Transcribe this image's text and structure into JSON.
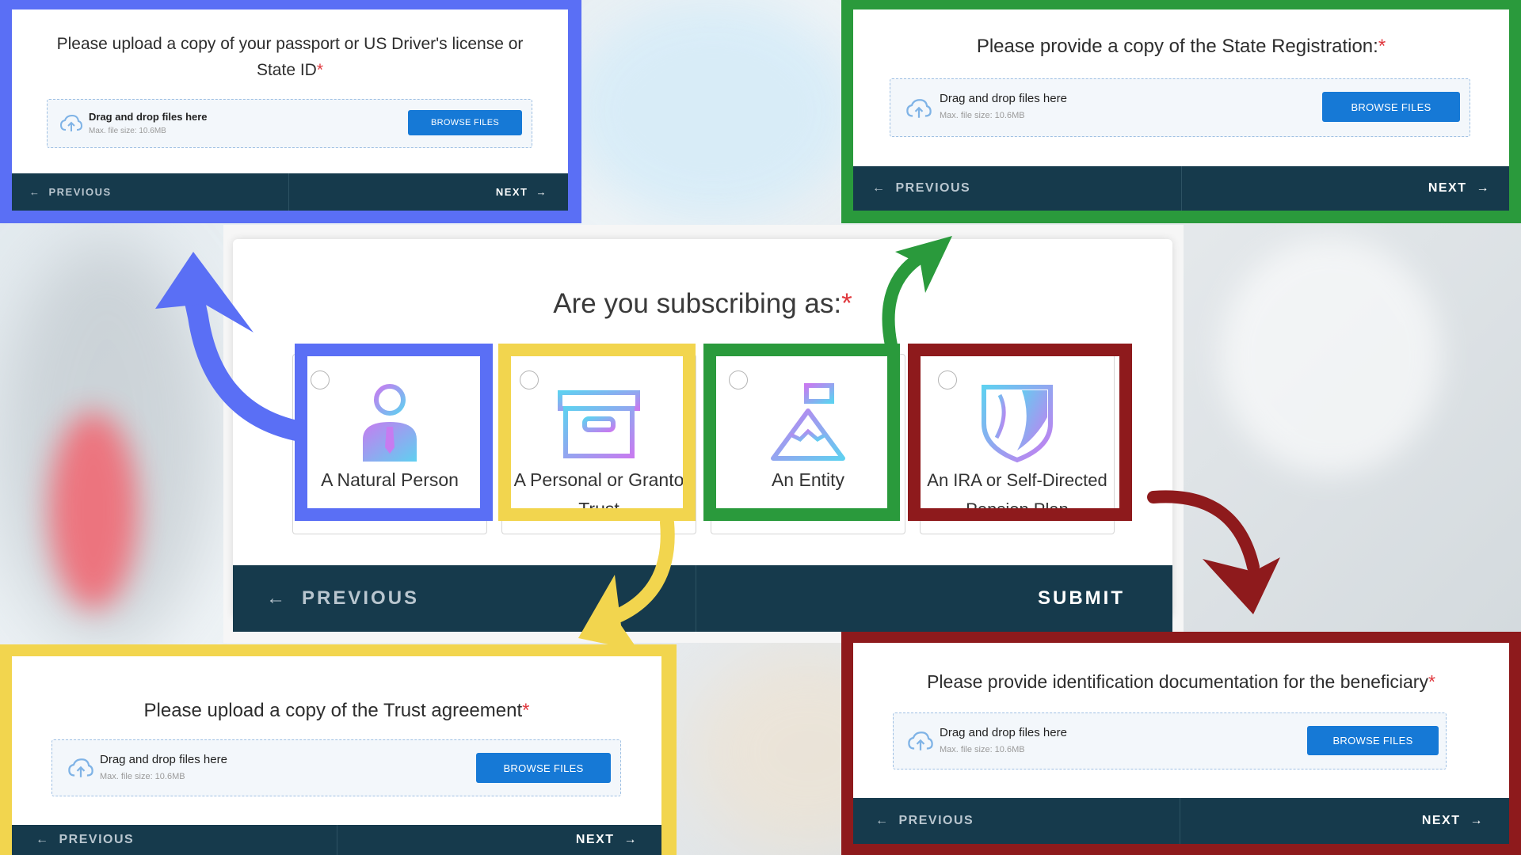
{
  "main": {
    "title": "Are you subscribing as:",
    "required_mark": "*",
    "options": [
      {
        "label": "A Natural Person",
        "icon": "person-icon"
      },
      {
        "label": "A Personal or Granto",
        "label2": "Trust",
        "icon": "archive-box-icon"
      },
      {
        "label": "An Entity",
        "icon": "mountain-flag-icon"
      },
      {
        "label": "An IRA or Self-Directed",
        "label2": "Pension Plan",
        "icon": "shield-icon"
      }
    ],
    "previous_label": "PREVIOUS",
    "submit_label": "SUBMIT"
  },
  "panels": {
    "passport": {
      "title_line1": "Please upload a copy of your passport or US Driver's license or",
      "title_line2": "State ID",
      "required_mark": "*",
      "drop_text": "Drag and drop files here",
      "max_size": "Max. file size: 10.6MB",
      "browse_label": "BROWSE FILES",
      "previous_label": "PREVIOUS",
      "next_label": "NEXT"
    },
    "state_registration": {
      "title": "Please provide a copy of the State Registration:",
      "required_mark": "*",
      "drop_text": "Drag and drop files here",
      "max_size": "Max. file size: 10.6MB",
      "browse_label": "BROWSE FILES",
      "previous_label": "PREVIOUS",
      "next_label": "NEXT"
    },
    "trust": {
      "title": "Please upload a copy of the Trust agreement",
      "required_mark": "*",
      "drop_text": "Drag and drop files here",
      "max_size": "Max. file size: 10.6MB",
      "browse_label": "BROWSE FILES",
      "previous_label": "PREVIOUS",
      "next_label": "NEXT"
    },
    "beneficiary": {
      "title": "Please provide identification documentation for the beneficiary",
      "required_mark": "*",
      "drop_text": "Drag and drop files here",
      "max_size": "Max. file size: 10.6MB",
      "browse_label": "BROWSE FILES",
      "previous_label": "PREVIOUS",
      "next_label": "NEXT"
    }
  },
  "colors": {
    "blue_highlight": "#5a6ff5",
    "green_highlight": "#2a9a3c",
    "yellow_highlight": "#f2d54e",
    "red_highlight": "#8e1a1c",
    "nav_bar": "#163a4c",
    "browse_button": "#1679d6",
    "required": "#e0383e"
  }
}
